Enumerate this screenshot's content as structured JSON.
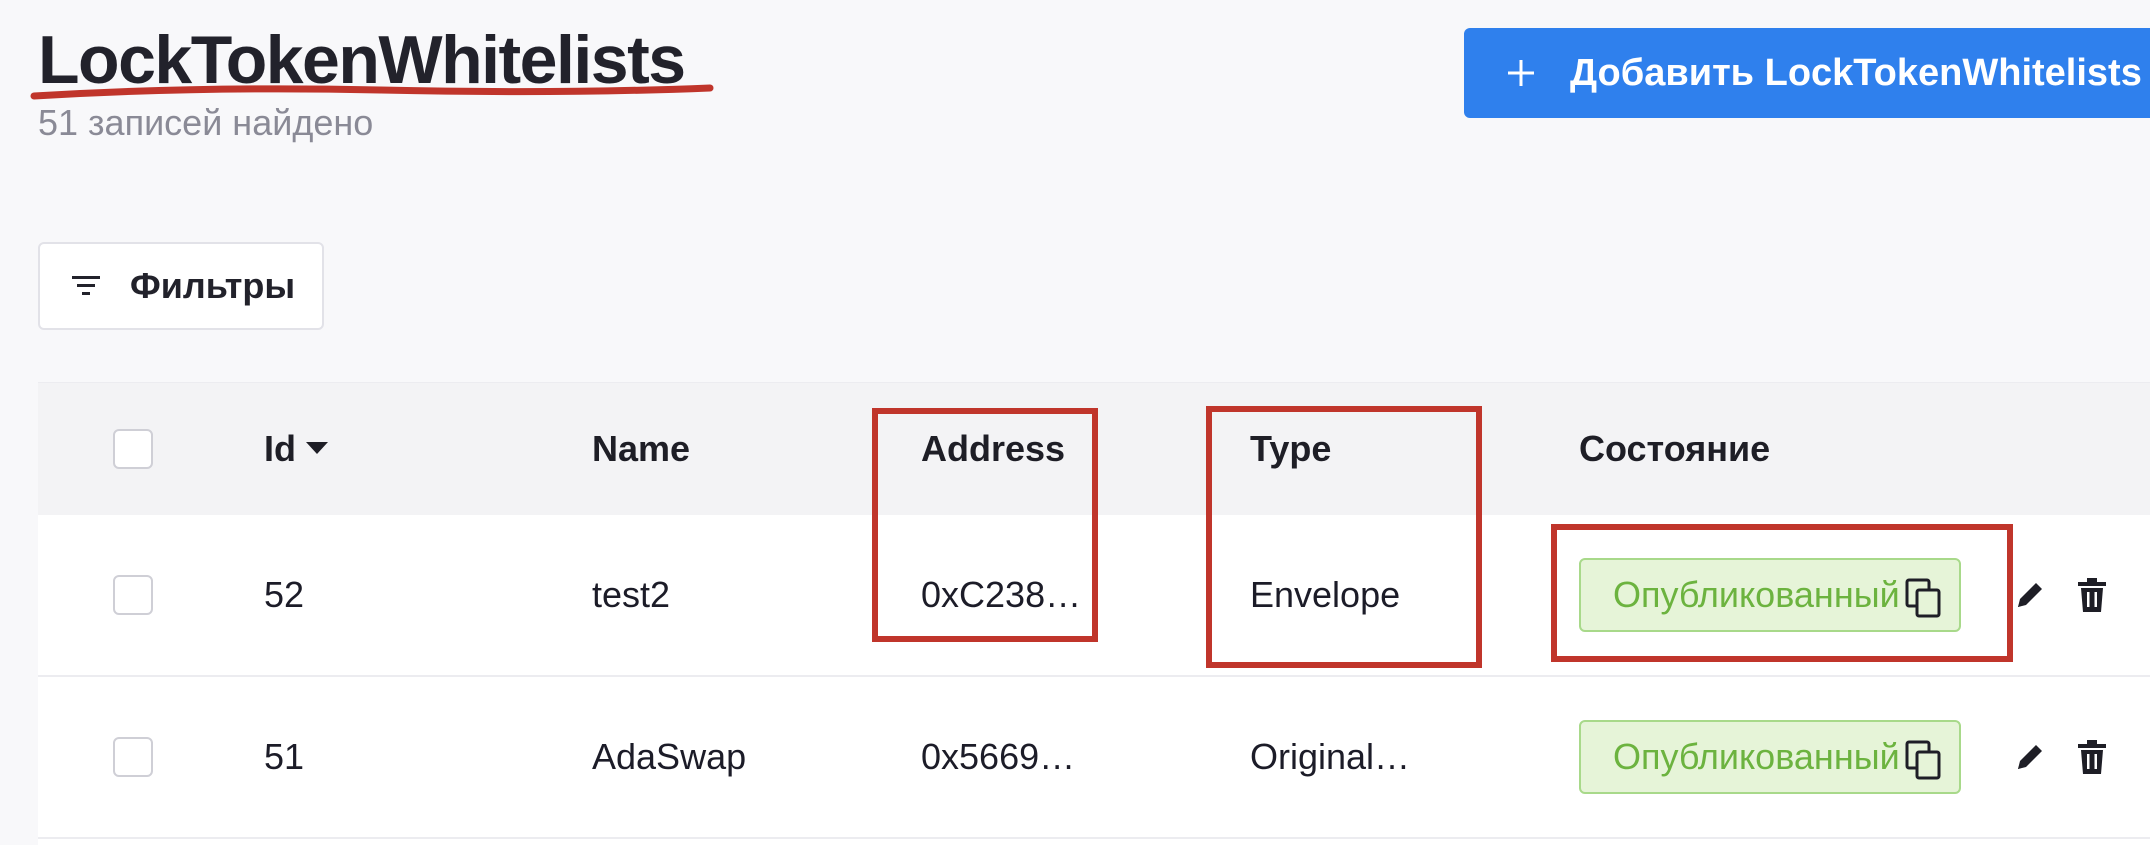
{
  "header": {
    "title": "LockTokenWhitelists",
    "subtitle": "51 записей найдено",
    "add_button_label": "Добавить LockTokenWhitelists"
  },
  "toolbar": {
    "filters_label": "Фильтры"
  },
  "table": {
    "columns": [
      "Id",
      "Name",
      "Address",
      "Type",
      "Состояние"
    ],
    "rows": [
      {
        "id": "52",
        "name": "test2",
        "address": "0xC238…",
        "type": "Envelope",
        "status": "Опубликованный"
      },
      {
        "id": "51",
        "name": "AdaSwap",
        "address": "0x5669…",
        "type": "Original…",
        "status": "Опубликованный"
      }
    ]
  },
  "icons": {
    "add": "plus-icon",
    "filters": "filter-icon",
    "sort": "sort-desc-icon",
    "copy": "copy-icon",
    "edit": "pencil-icon",
    "delete": "trash-icon"
  },
  "colors": {
    "primary": "#2f80ed",
    "status_text": "#6cb33f",
    "status_bg": "#e6f4d8",
    "annotation": "#c0352b"
  }
}
